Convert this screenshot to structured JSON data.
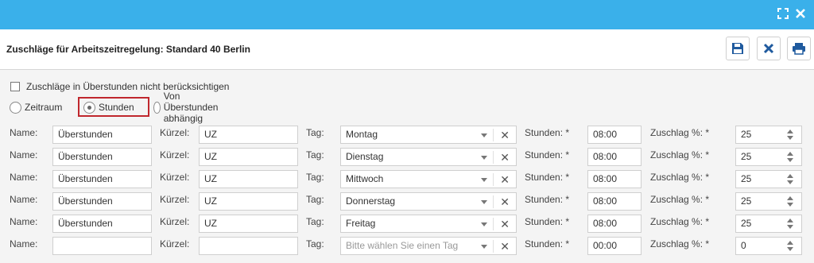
{
  "header": {
    "title": "Zuschläge für Arbeitszeitregelung: Standard 40 Berlin"
  },
  "topbar": {
    "icons": [
      "expand-icon",
      "close-icon"
    ]
  },
  "toolbar": {
    "icons": [
      "save-icon",
      "delete-icon",
      "print-icon"
    ]
  },
  "options": {
    "ignore_overtime_label": "Zuschläge in Überstunden nicht berücksichtigen",
    "ignore_overtime_checked": false,
    "radio": [
      {
        "label": "Zeitraum",
        "selected": false
      },
      {
        "label": "Stunden",
        "selected": true
      },
      {
        "label": "Von Überstunden abhängig",
        "selected": false
      }
    ]
  },
  "labels": {
    "name": "Name:",
    "kuerzel": "Kürzel:",
    "tag": "Tag:",
    "stunden": "Stunden: *",
    "zuschlag": "Zuschlag %: *"
  },
  "rows": [
    {
      "name": "Überstunden",
      "kuerzel": "UZ",
      "tag": "Montag",
      "stunden": "08:00",
      "zuschlag": "25"
    },
    {
      "name": "Überstunden",
      "kuerzel": "UZ",
      "tag": "Dienstag",
      "stunden": "08:00",
      "zuschlag": "25"
    },
    {
      "name": "Überstunden",
      "kuerzel": "UZ",
      "tag": "Mittwoch",
      "stunden": "08:00",
      "zuschlag": "25"
    },
    {
      "name": "Überstunden",
      "kuerzel": "UZ",
      "tag": "Donnerstag",
      "stunden": "08:00",
      "zuschlag": "25"
    },
    {
      "name": "Überstunden",
      "kuerzel": "UZ",
      "tag": "Freitag",
      "stunden": "08:00",
      "zuschlag": "25"
    },
    {
      "name": "",
      "kuerzel": "",
      "tag": "",
      "tag_placeholder": "Bitte wählen Sie einen Tag",
      "stunden": "00:00",
      "zuschlag": "0"
    }
  ],
  "colors": {
    "topbar": "#3ab0ea",
    "icon_blue": "#1f5a9e",
    "highlight": "#c0272d"
  }
}
